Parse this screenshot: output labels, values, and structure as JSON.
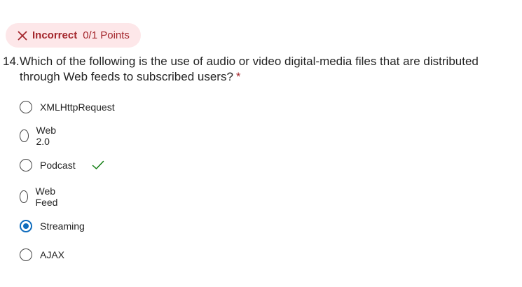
{
  "result": {
    "status_icon": "close-icon",
    "status_label": "Incorrect",
    "points": "0/1 Points",
    "status_color": "#a4262c",
    "background_color": "#fde7e9"
  },
  "question": {
    "number": "14.",
    "text": "Which of the following is the use of audio or video digital-media files that are distributed through Web feeds to subscribed users?",
    "required_marker": "*"
  },
  "options": [
    {
      "label": "XMLHttpRequest",
      "selected": false,
      "correct": false
    },
    {
      "label": "Web 2.0",
      "selected": false,
      "correct": false
    },
    {
      "label": "Podcast",
      "selected": false,
      "correct": true,
      "correct_icon": "checkmark-icon"
    },
    {
      "label": "Web Feed",
      "selected": false,
      "correct": false
    },
    {
      "label": "Streaming",
      "selected": true,
      "correct": false
    },
    {
      "label": "AJAX",
      "selected": false,
      "correct": false
    }
  ],
  "colors": {
    "accent": "#0f6cbd",
    "correct_check": "#107c10"
  }
}
